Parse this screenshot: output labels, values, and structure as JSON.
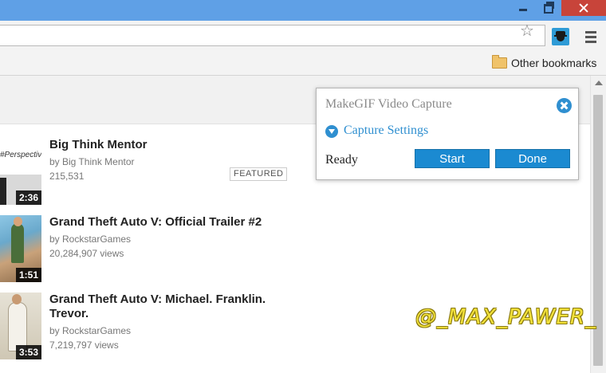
{
  "toolbar": {
    "star_icon": "star-icon",
    "extension_icon": "makegif-extension-icon",
    "menu_icon": "menu-icon"
  },
  "bookmarks_bar": {
    "folder_icon": "folder-icon",
    "other_bookmarks": "Other bookmarks"
  },
  "videos": [
    {
      "title": "Big Think Mentor",
      "channel": "by Big Think Mentor",
      "views": "215,531",
      "duration": "2:36",
      "badge": "FEATURED",
      "thumb_text": "#Perspective"
    },
    {
      "title": "Grand Theft Auto V: Official Trailer #2",
      "channel": "by RockstarGames",
      "views": "20,284,907 views",
      "duration": "1:51"
    },
    {
      "title": "Grand Theft Auto V: Michael. Franklin. Trevor.",
      "channel": "by RockstarGames",
      "views": "7,219,797 views",
      "duration": "3:53"
    }
  ],
  "popup": {
    "title": "MakeGIF Video Capture",
    "settings_link": "Capture Settings",
    "status": "Ready",
    "start_label": "Start",
    "done_label": "Done",
    "accent_color": "#1b8ad1"
  },
  "watermark": "@_MAX_PAWER_"
}
